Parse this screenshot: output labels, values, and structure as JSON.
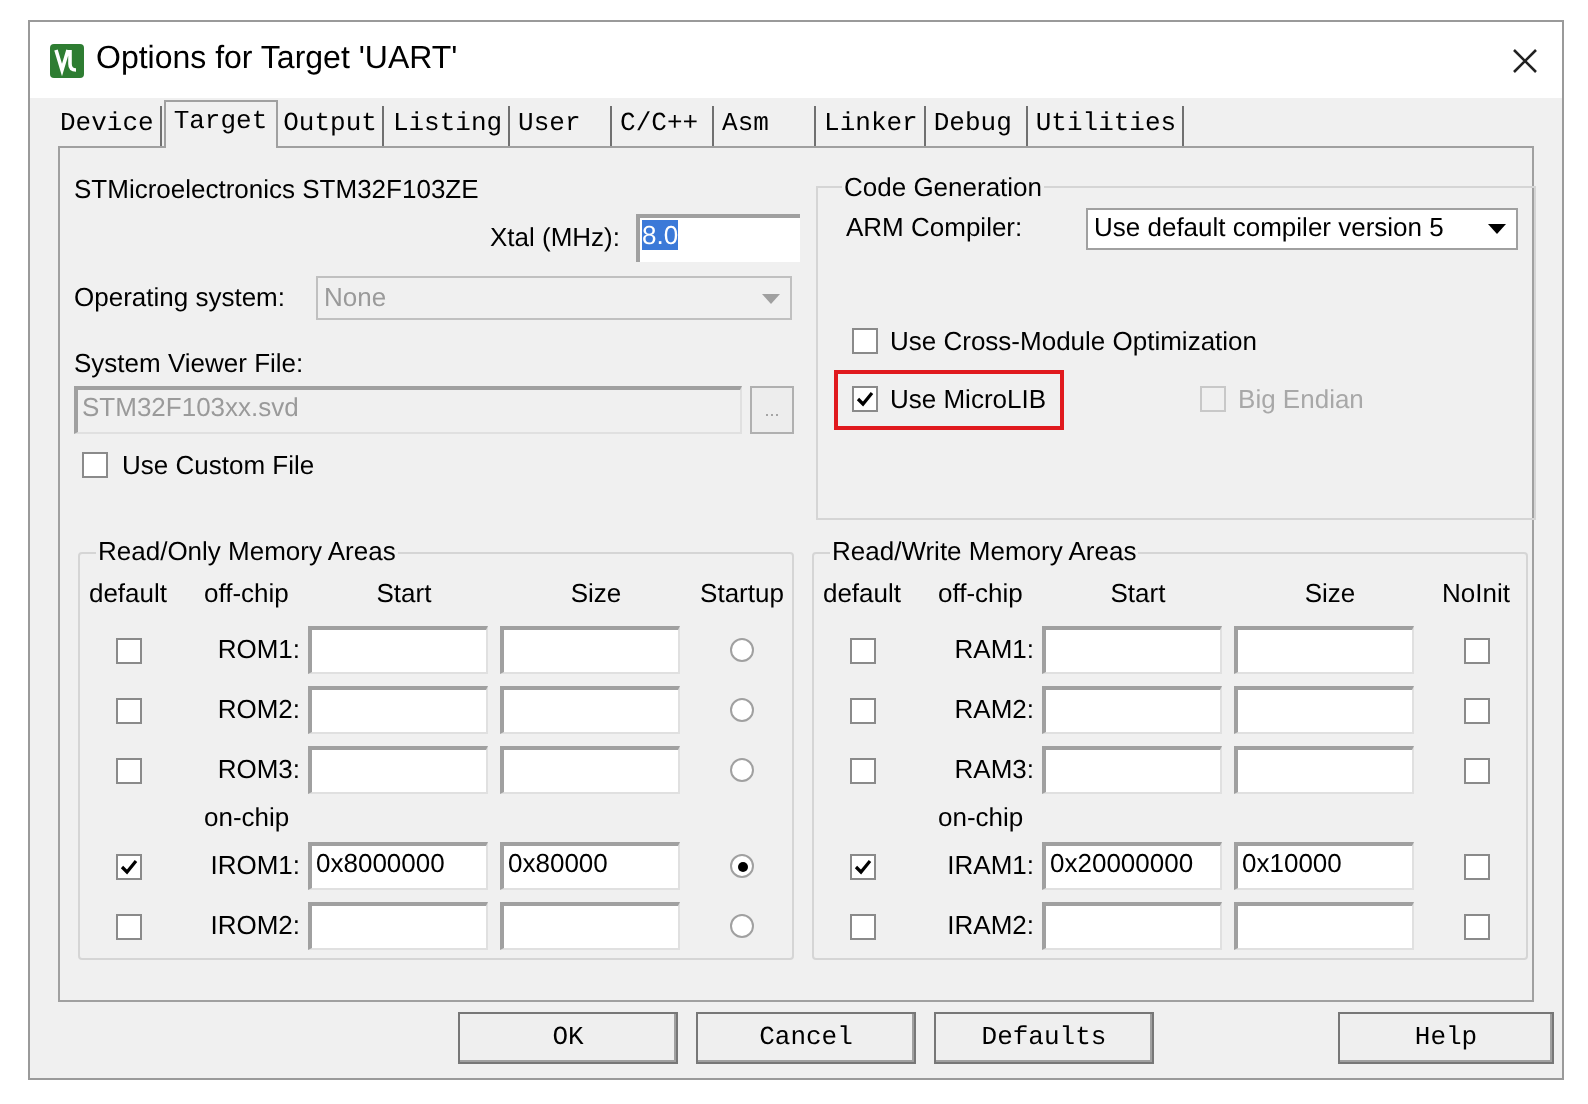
{
  "window": {
    "title": "Options for Target 'UART'"
  },
  "tabs": [
    {
      "label": "Device",
      "selected": false
    },
    {
      "label": "Target",
      "selected": true
    },
    {
      "label": "Output",
      "selected": false
    },
    {
      "label": "Listing",
      "selected": false
    },
    {
      "label": "User",
      "selected": false
    },
    {
      "label": "C/C++",
      "selected": false
    },
    {
      "label": "Asm",
      "selected": false
    },
    {
      "label": "Linker",
      "selected": false
    },
    {
      "label": "Debug",
      "selected": false
    },
    {
      "label": "Utilities",
      "selected": false
    }
  ],
  "device": {
    "name": "STMicroelectronics STM32F103ZE"
  },
  "xtal": {
    "label": "Xtal (MHz):",
    "value": "8.0",
    "text_selected": true
  },
  "operating_system": {
    "label": "Operating system:",
    "value": "None",
    "disabled": true
  },
  "system_viewer_file": {
    "label": "System Viewer File:",
    "value": "STM32F103xx.svd",
    "disabled": true,
    "browse_button": "..."
  },
  "use_custom_file": {
    "label": "Use Custom File",
    "checked": false
  },
  "code_generation": {
    "title": "Code Generation",
    "arm_compiler_label": "ARM Compiler:",
    "arm_compiler_value": "Use default compiler version 5",
    "rows": [
      {
        "options": [
          {
            "label": "Use Cross-Module Optimization",
            "checked": false,
            "disabled": false,
            "highlighted": false
          }
        ]
      },
      {
        "options": [
          {
            "label": "Use MicroLIB",
            "checked": true,
            "disabled": false,
            "highlighted": true
          },
          {
            "label": "Big Endian",
            "checked": false,
            "disabled": true,
            "highlighted": false
          }
        ]
      }
    ]
  },
  "memory_groups": [
    {
      "title": "Read/Only Memory Areas",
      "kind": "rom",
      "columns": [
        "default",
        "off-chip",
        "Start",
        "Size",
        "Startup"
      ],
      "rows": [
        {
          "kind": "memory",
          "default": false,
          "label": "ROM1:",
          "selected": false
        },
        {
          "kind": "memory",
          "default": false,
          "label": "ROM2:",
          "selected": false
        },
        {
          "kind": "memory",
          "default": false,
          "label": "ROM3:",
          "selected": false
        },
        {
          "kind": "heading",
          "label": "on-chip"
        },
        {
          "kind": "memory",
          "default": true,
          "label": "IROM1:",
          "start": "0x8000000",
          "size": "0x80000",
          "selected": true
        },
        {
          "kind": "memory",
          "default": false,
          "label": "IROM2:",
          "selected": false
        }
      ]
    },
    {
      "title": "Read/Write Memory Areas",
      "kind": "ram",
      "columns": [
        "default",
        "off-chip",
        "Start",
        "Size",
        "NoInit"
      ],
      "rows": [
        {
          "kind": "memory",
          "default": false,
          "label": "RAM1:",
          "noinit": false
        },
        {
          "kind": "memory",
          "default": false,
          "label": "RAM2:",
          "noinit": false
        },
        {
          "kind": "memory",
          "default": false,
          "label": "RAM3:",
          "noinit": false
        },
        {
          "kind": "heading",
          "label": "on-chip"
        },
        {
          "kind": "memory",
          "default": true,
          "label": "IRAM1:",
          "start": "0x20000000",
          "size": "0x10000",
          "noinit": false
        },
        {
          "kind": "memory",
          "default": false,
          "label": "IRAM2:",
          "noinit": false
        }
      ]
    }
  ],
  "buttons": [
    "OK",
    "Cancel",
    "Defaults"
  ],
  "help_button": "Help"
}
